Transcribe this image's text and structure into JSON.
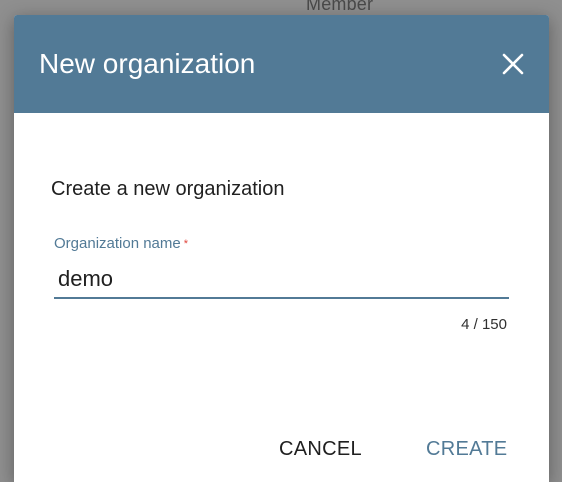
{
  "backdrop": {
    "partial_text": "Member"
  },
  "dialog": {
    "title": "New organization",
    "subtitle": "Create a new organization",
    "field": {
      "label": "Organization name",
      "required_mark": "*",
      "value": "demo",
      "counter": "4 / 150"
    },
    "actions": {
      "cancel_label": "CANCEL",
      "create_label": "CREATE"
    }
  },
  "colors": {
    "header": "#527a96",
    "accent": "#527a96",
    "required": "#e0443a",
    "backdrop": "#8f8f8f"
  },
  "icons": {
    "close": "close-icon"
  }
}
